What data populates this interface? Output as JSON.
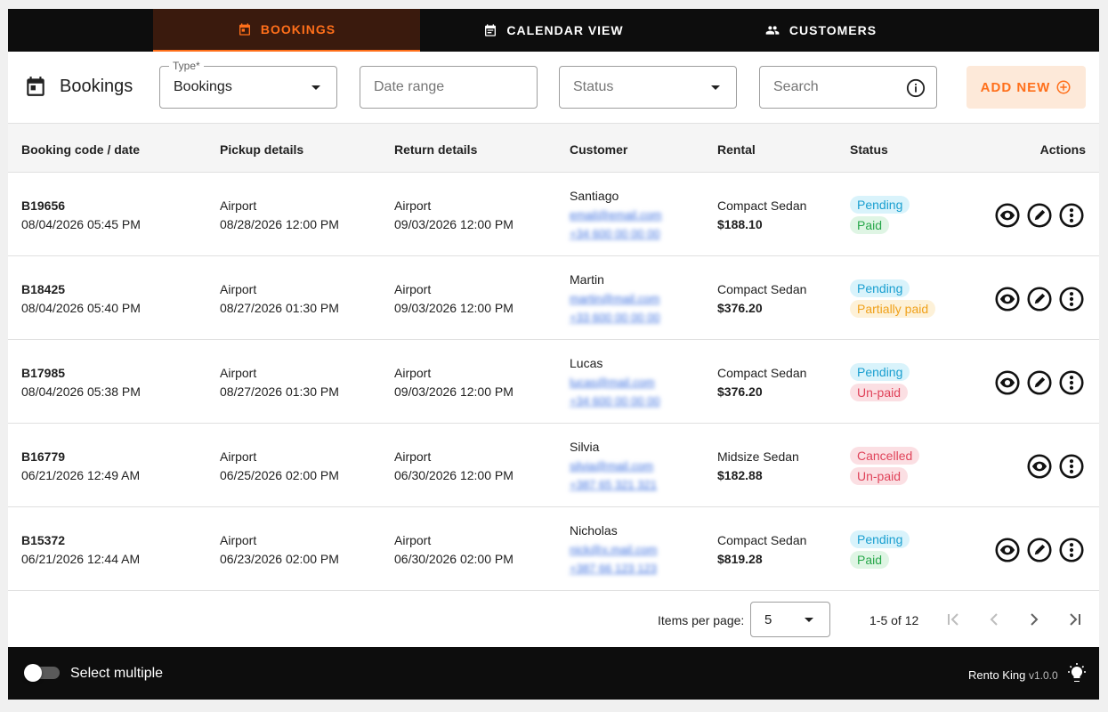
{
  "nav": {
    "tabs": [
      {
        "label": "BOOKINGS",
        "icon": "calendar-icon"
      },
      {
        "label": "CALENDAR VIEW",
        "icon": "calendar-view-icon"
      },
      {
        "label": "CUSTOMERS",
        "icon": "people-icon"
      }
    ],
    "active_color": "#ff6f1a"
  },
  "toolbar": {
    "title": "Bookings",
    "type_label": "Type*",
    "type_value": "Bookings",
    "date_placeholder": "Date range",
    "status_placeholder": "Status",
    "search_placeholder": "Search",
    "add_label": "ADD NEW"
  },
  "table": {
    "headers": [
      "Booking code / date",
      "Pickup details",
      "Return details",
      "Customer",
      "Rental",
      "Status",
      "Actions"
    ],
    "rows": [
      {
        "code": "B19656",
        "date": "08/04/2026 05:45 PM",
        "pickup_loc": "Airport",
        "pickup_time": "08/28/2026 12:00 PM",
        "return_loc": "Airport",
        "return_time": "09/03/2026 12:00 PM",
        "customer": "Santiago",
        "email": "email@email.com",
        "phone": "+34 600 00 00 00",
        "car": "Compact Sedan",
        "price": "$188.10",
        "status": "Pending",
        "payment": "Paid",
        "editable": true
      },
      {
        "code": "B18425",
        "date": "08/04/2026 05:40 PM",
        "pickup_loc": "Airport",
        "pickup_time": "08/27/2026 01:30 PM",
        "return_loc": "Airport",
        "return_time": "09/03/2026 12:00 PM",
        "customer": "Martin",
        "email": "martin@mail.com",
        "phone": "+33 600 00 00 00",
        "car": "Compact Sedan",
        "price": "$376.20",
        "status": "Pending",
        "payment": "Partially paid",
        "editable": true
      },
      {
        "code": "B17985",
        "date": "08/04/2026 05:38 PM",
        "pickup_loc": "Airport",
        "pickup_time": "08/27/2026 01:30 PM",
        "return_loc": "Airport",
        "return_time": "09/03/2026 12:00 PM",
        "customer": "Lucas",
        "email": "lucas@mail.com",
        "phone": "+34 600 00 00 00",
        "car": "Compact Sedan",
        "price": "$376.20",
        "status": "Pending",
        "payment": "Un-paid",
        "editable": true
      },
      {
        "code": "B16779",
        "date": "06/21/2026 12:49 AM",
        "pickup_loc": "Airport",
        "pickup_time": "06/25/2026 02:00 PM",
        "return_loc": "Airport",
        "return_time": "06/30/2026 12:00 PM",
        "customer": "Silvia",
        "email": "silvia@mail.com",
        "phone": "+387 65 321 321",
        "car": "Midsize Sedan",
        "price": "$182.88",
        "status": "Cancelled",
        "payment": "Un-paid",
        "editable": false
      },
      {
        "code": "B15372",
        "date": "06/21/2026 12:44 AM",
        "pickup_loc": "Airport",
        "pickup_time": "06/23/2026 02:00 PM",
        "return_loc": "Airport",
        "return_time": "06/30/2026 02:00 PM",
        "customer": "Nicholas",
        "email": "nick@x.mail.com",
        "phone": "+387 66 123 123",
        "car": "Compact Sedan",
        "price": "$819.28",
        "status": "Pending",
        "payment": "Paid",
        "editable": true
      }
    ]
  },
  "badge_colors": {
    "Pending": {
      "bg": "#d9f3fb",
      "fg": "#1a9fd0"
    },
    "Paid": {
      "bg": "#dff5e4",
      "fg": "#27a74a"
    },
    "Partially paid": {
      "bg": "#fdf1d8",
      "fg": "#f0a11a"
    },
    "Un-paid": {
      "bg": "#fbdfe3",
      "fg": "#e0435a"
    },
    "Cancelled": {
      "bg": "#fbdfe3",
      "fg": "#e0435a"
    }
  },
  "pagination": {
    "items_per_page_label": "Items per page:",
    "items_per_page": "5",
    "range": "1-5 of 12"
  },
  "footer": {
    "select_multiple": "Select multiple",
    "brand": "Rento King",
    "version": "v1.0.0"
  }
}
